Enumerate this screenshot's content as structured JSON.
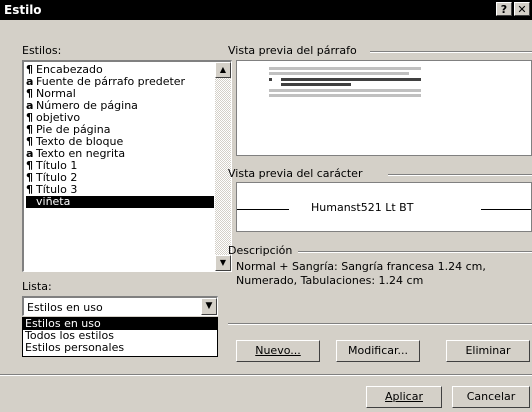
{
  "window": {
    "title": "Estilo",
    "help_btn": "?",
    "close_btn": "✕"
  },
  "styles": {
    "label": "Estilos:",
    "items": [
      {
        "glyph": "¶",
        "label": "Encabezado"
      },
      {
        "glyph": "a",
        "label": "Fuente de párrafo predeter"
      },
      {
        "glyph": "¶",
        "label": "Normal"
      },
      {
        "glyph": "a",
        "label": "Número de página"
      },
      {
        "glyph": "¶",
        "label": "objetivo"
      },
      {
        "glyph": "¶",
        "label": "Pie de página"
      },
      {
        "glyph": "¶",
        "label": "Texto de bloque"
      },
      {
        "glyph": "a",
        "label": "Texto en negrita"
      },
      {
        "glyph": "¶",
        "label": "Título 1"
      },
      {
        "glyph": "¶",
        "label": "Título 2"
      },
      {
        "glyph": "¶",
        "label": "Título 3"
      },
      {
        "glyph": "",
        "label": "viñeta"
      }
    ],
    "selected": "viñeta"
  },
  "paragraph_preview": {
    "label": "Vista previa del párrafo"
  },
  "character_preview": {
    "label": "Vista previa del carácter",
    "font_name": "Humanst521 Lt BT"
  },
  "description": {
    "label": "Descripción",
    "line1": "Normal + Sangría:  Sangría francesa  1.24 cm,",
    "line2": "Numerado, Tabulaciones: 1.24 cm"
  },
  "list": {
    "label": "Lista:",
    "value": "Estilos en uso",
    "options": [
      "Estilos en uso",
      "Todos los estilos",
      "Estilos personales"
    ]
  },
  "buttons": {
    "new": "Nuevo...",
    "modify": "Modificar...",
    "delete": "Eliminar",
    "apply": "Aplicar",
    "cancel": "Cancelar"
  }
}
